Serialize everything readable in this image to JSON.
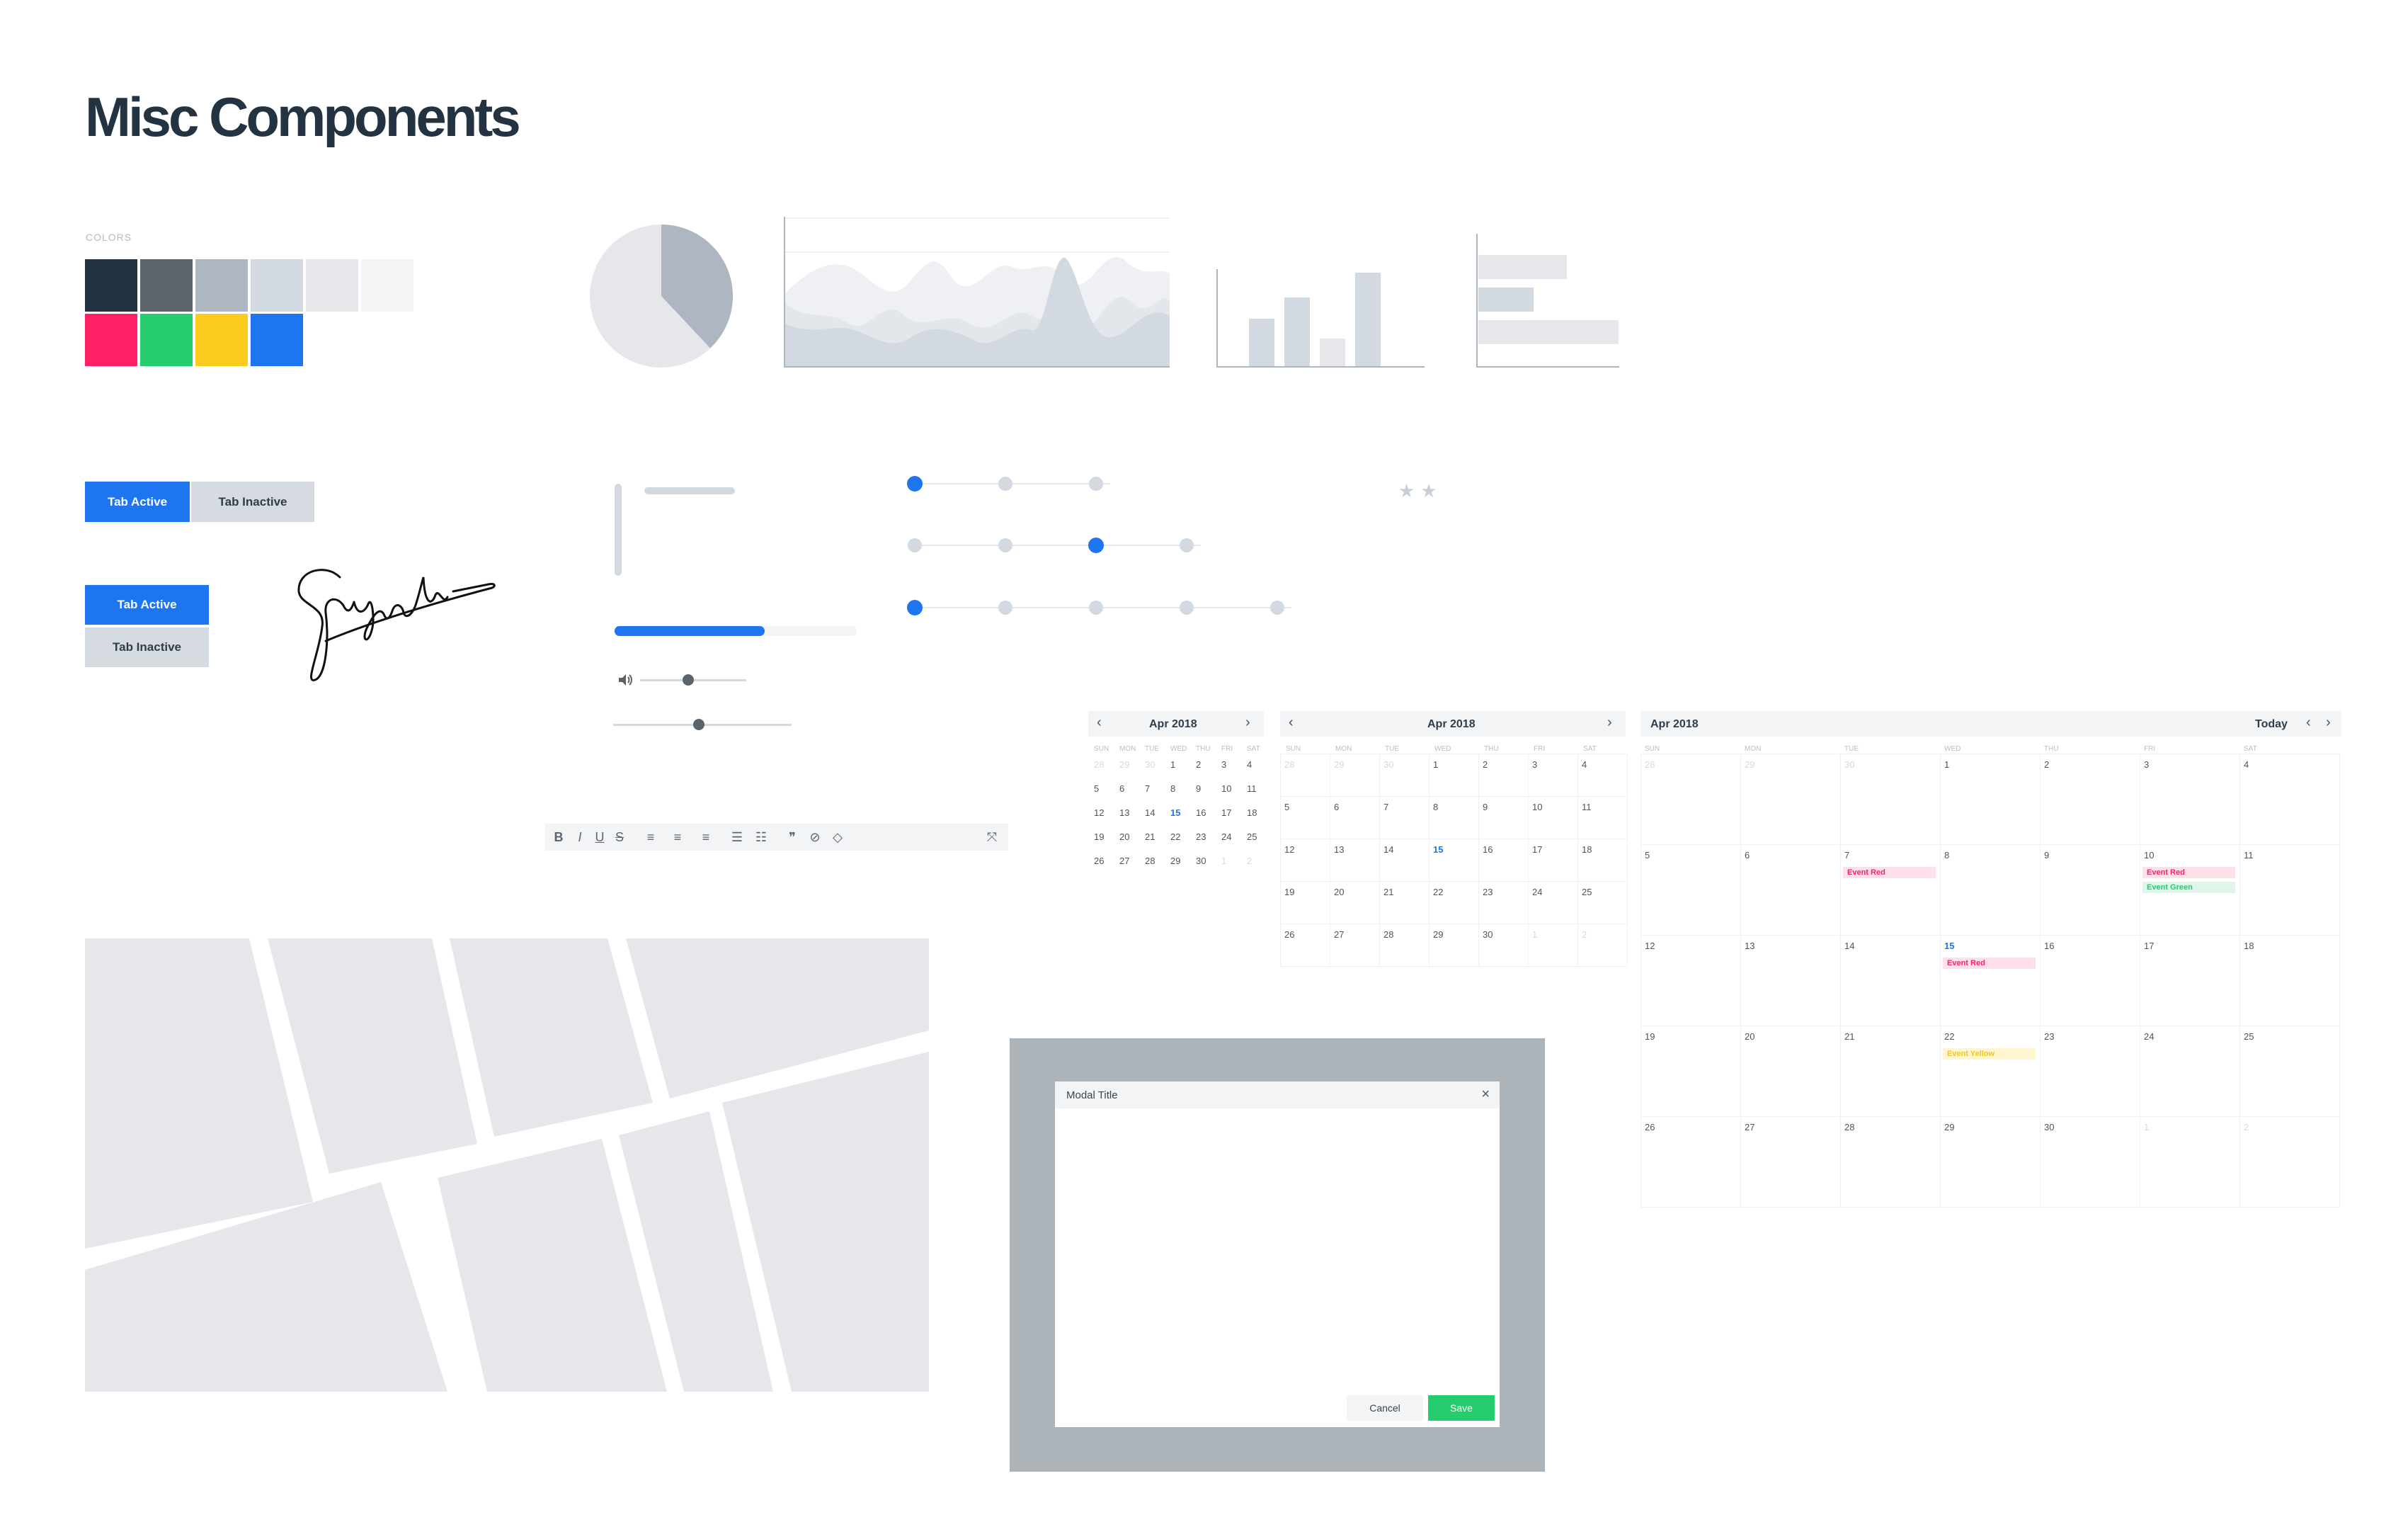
{
  "page": {
    "title": "Misc Components"
  },
  "colors": {
    "label": "COLORS",
    "row1": [
      "#243342",
      "#5b636b",
      "#adb6c1",
      "#d3d9e0",
      "#e5e7eb",
      "#f3f4f6"
    ],
    "row2": [
      "#ff2065",
      "#26cd6d",
      "#fbcc1e",
      "#1d75f0"
    ]
  },
  "tabs": {
    "horizontal": {
      "active": "Tab Active",
      "inactive": "Tab Inactive"
    },
    "vertical": {
      "active": "Tab Active",
      "inactive": "Tab Inactive"
    }
  },
  "pie": {
    "slices": [
      0.38,
      0.62
    ]
  },
  "progress": {
    "value": 0.62
  },
  "volume": {
    "value": 0.45
  },
  "slider": {
    "value": 0.48
  },
  "steppers": [
    {
      "steps": 3,
      "active": 0
    },
    {
      "steps": 4,
      "active": 2
    },
    {
      "steps": 5,
      "active": 0
    }
  ],
  "rating": {
    "stars": 2
  },
  "editor": {
    "buttons": [
      "bold-icon",
      "italic-icon",
      "underline-icon",
      "strikethrough-icon",
      "align-left-icon",
      "align-center-icon",
      "align-right-icon",
      "bullet-list-icon",
      "numbered-list-icon",
      "quote-icon",
      "link-icon",
      "code-icon",
      "fullscreen-icon"
    ]
  },
  "calendar": {
    "month": "Apr 2018",
    "today_label": "Today",
    "weekdays": [
      "SUN",
      "MON",
      "TUE",
      "WED",
      "THU",
      "FRI",
      "SAT"
    ],
    "weeks": [
      [
        "28",
        "29",
        "30",
        "1",
        "2",
        "3",
        "4"
      ],
      [
        "5",
        "6",
        "7",
        "8",
        "9",
        "10",
        "11"
      ],
      [
        "12",
        "13",
        "14",
        "15",
        "16",
        "17",
        "18"
      ],
      [
        "19",
        "20",
        "21",
        "22",
        "23",
        "24",
        "25"
      ],
      [
        "26",
        "27",
        "28",
        "29",
        "30",
        "1",
        "2"
      ]
    ],
    "today": "15",
    "events": [
      {
        "week": 1,
        "day": 2,
        "label": "Event Red",
        "type": "red"
      },
      {
        "week": 1,
        "day": 5,
        "label": "Event Red",
        "type": "red"
      },
      {
        "week": 1,
        "day": 5,
        "label": "Event Green",
        "type": "green"
      },
      {
        "week": 2,
        "day": 3,
        "label": "Event Red",
        "type": "red"
      },
      {
        "week": 3,
        "day": 3,
        "label": "Event Yellow",
        "type": "yellow"
      }
    ]
  },
  "modal": {
    "title": "Modal Title",
    "cancel": "Cancel",
    "save": "Save",
    "close": "×"
  }
}
